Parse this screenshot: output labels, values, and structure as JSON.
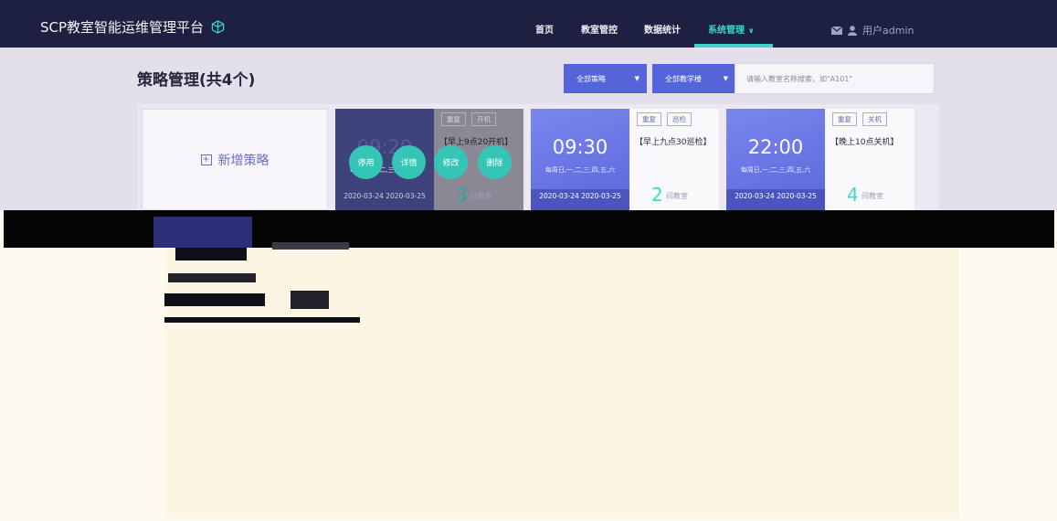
{
  "header": {
    "app_title": "SCP教室智能运维管理平台",
    "nav": [
      {
        "label": "首页",
        "active": false
      },
      {
        "label": "教室管控",
        "active": false
      },
      {
        "label": "数据统计",
        "active": false
      },
      {
        "label": "系统管理",
        "active": true
      }
    ],
    "user_label": "用户admin"
  },
  "page": {
    "title": "策略管理(共4个)"
  },
  "filters": {
    "strategy_select": "全部策略",
    "building_select": "全部教学楼",
    "search_placeholder": "请输入教室名称搜索，如\"A101\""
  },
  "add_card": {
    "label": "新增策略"
  },
  "strategies": [
    {
      "time": "09:20",
      "days": "每周日,一,二,三,四,五,六",
      "dates": "2020-03-24 2020-03-25",
      "tags": [
        "重复",
        "开机"
      ],
      "name": "【早上9点20开机】",
      "count": "3",
      "count_unit": "间教室",
      "actions": [
        "停用",
        "详情",
        "修改",
        "删除"
      ]
    },
    {
      "time": "09:30",
      "days": "每周日,一,二,三,四,五,六",
      "dates": "2020-03-24 2020-03-25",
      "tags": [
        "重复",
        "巡检"
      ],
      "name": "【早上九点30巡检】",
      "count": "2",
      "count_unit": "间教室"
    },
    {
      "time": "22:00",
      "days": "每周日,一,二,三,四,五,六",
      "dates": "2020-03-24 2020-03-25",
      "tags": [
        "重复",
        "关机"
      ],
      "name": "【晚上10点关机】",
      "count": "4",
      "count_unit": "间教室"
    }
  ],
  "colors": {
    "header_bg": "#1d2040",
    "accent_teal": "#3fd6c9",
    "primary_blue": "#5564d8"
  }
}
